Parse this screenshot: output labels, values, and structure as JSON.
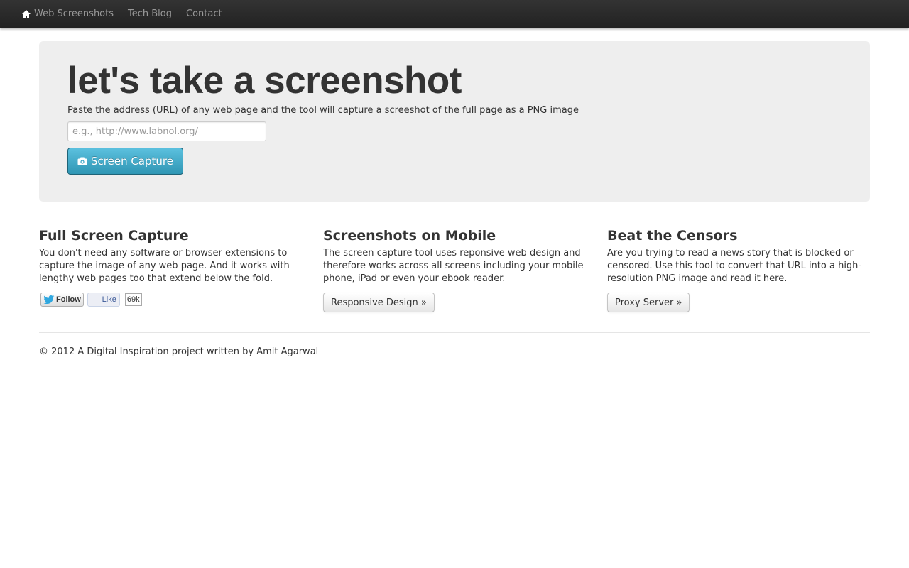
{
  "nav": {
    "brand_label": "Web Screenshots",
    "brand_icon": "home-icon",
    "items": [
      {
        "label": "Tech Blog"
      },
      {
        "label": "Contact"
      }
    ]
  },
  "hero": {
    "title": "let's take a screenshot",
    "description": "Paste the address (URL) of any web page and the tool will capture a screeshot of the full page as a PNG image",
    "input": {
      "value": "",
      "placeholder": "e.g., http://www.labnol.org/"
    },
    "button": {
      "label": "Screen Capture",
      "icon": "camera-icon",
      "color": "#49afcd"
    }
  },
  "columns": [
    {
      "title": "Full Screen Capture",
      "text": "You don't need any software or browser extensions to capture the image of any web page. And it works with lengthy web pages too that extend below the fold.",
      "social": {
        "follow_label": "Follow",
        "like_label": "Like",
        "like_count": "69k"
      }
    },
    {
      "title": "Screenshots on Mobile",
      "text": "The screen capture tool uses reponsive web design and therefore works across all screens including your mobile phone, iPad or even your ebook reader.",
      "button_label": "Responsive Design »"
    },
    {
      "title": "Beat the Censors",
      "text": "Are you trying to read a news story that is blocked or censored. Use this tool to convert that URL into a high-resolution PNG image and read it here.",
      "button_label": "Proxy Server »"
    }
  ],
  "footer": {
    "text": "© 2012 A Digital Inspiration project written by Amit Agarwal"
  },
  "colors": {
    "navbar": "#222222",
    "hero_bg": "#eeeeee",
    "accent": "#49afcd"
  }
}
